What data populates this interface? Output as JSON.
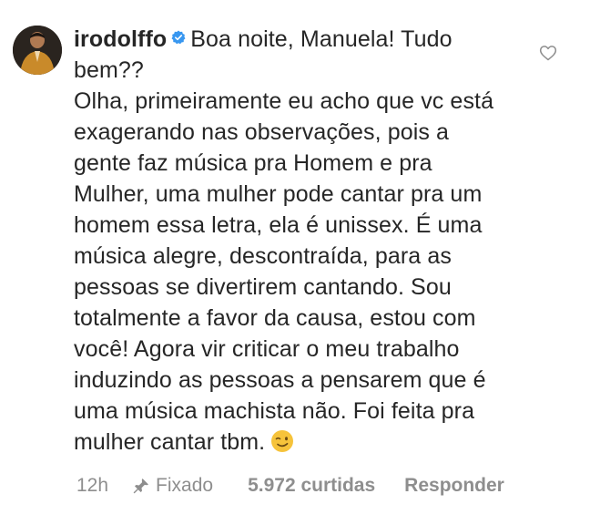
{
  "comment": {
    "username": "irodolffo",
    "verified_icon": "verified-badge-icon",
    "greeting": "Boa noite, Manuela! Tudo bem??",
    "body": "Olha, primeiramente eu acho que vc está exagerando nas observações, pois a gente faz música pra Homem e pra Mulher, uma mulher pode cantar pra um homem essa letra, ela é unissex. É uma música alegre, descontraída, para as pessoas se divertirem cantando. Sou totalmente a favor da causa, estou com você! Agora vir criticar o meu trabalho induzindo as pessoas a pensarem que é uma música machista não. Foi feita pra mulher cantar tbm.",
    "emoji": "winking-face-emoji",
    "like_icon": "heart-outline-icon"
  },
  "meta": {
    "time": "12h",
    "pin_icon": "pin-icon",
    "pinned_label": "Fixado",
    "likes": "5.972 curtidas",
    "reply_label": "Responder"
  },
  "colors": {
    "text": "#262626",
    "secondary": "#8e8e8e",
    "verified": "#3897f0",
    "background": "#ffffff"
  }
}
